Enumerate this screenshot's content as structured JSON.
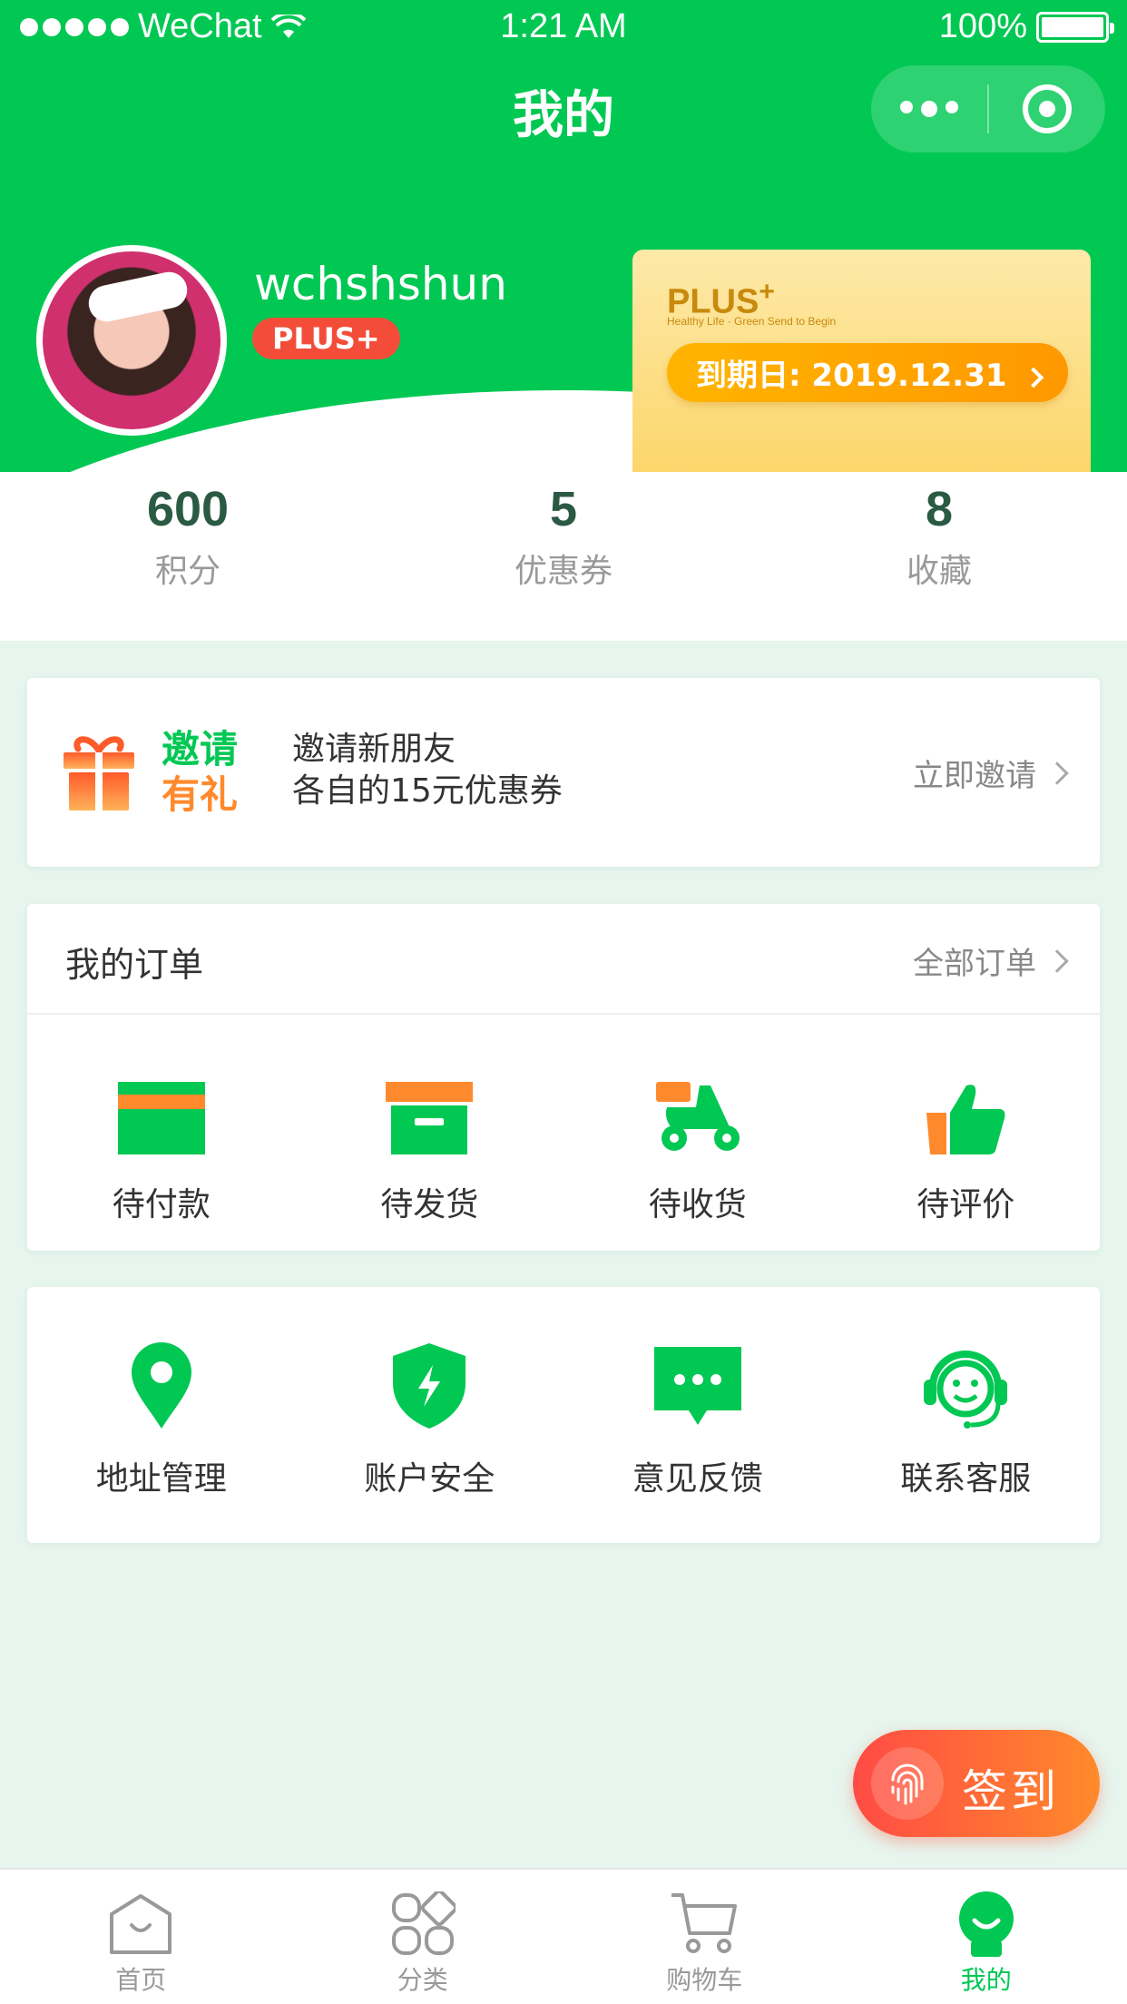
{
  "status_bar": {
    "carrier": "WeChat",
    "time": "1:21 AM",
    "battery": "100%"
  },
  "header": {
    "title": "我的"
  },
  "profile": {
    "username": "wchshshun",
    "badge": "PLUS+",
    "plus_card": {
      "brand": "PLUS",
      "slogan": "Healthy Life · Green Send to Begin",
      "expire_label": "到期日: 2019.12.31"
    }
  },
  "stats": [
    {
      "value": "600",
      "label": "积分"
    },
    {
      "value": "5",
      "label": "优惠券"
    },
    {
      "value": "8",
      "label": "收藏"
    }
  ],
  "invite": {
    "tag_line1": "邀请",
    "tag_line2": "有礼",
    "text_line1": "邀请新朋友",
    "text_line2": "各自的15元优惠券",
    "action": "立即邀请"
  },
  "orders": {
    "title": "我的订单",
    "all_link": "全部订单",
    "items": [
      {
        "label": "待付款",
        "icon": "card-icon"
      },
      {
        "label": "待发货",
        "icon": "box-icon"
      },
      {
        "label": "待收货",
        "icon": "scooter-icon"
      },
      {
        "label": "待评价",
        "icon": "thumbs-up-icon"
      }
    ]
  },
  "services": {
    "items": [
      {
        "label": "地址管理",
        "icon": "location-pin-icon"
      },
      {
        "label": "账户安全",
        "icon": "shield-icon"
      },
      {
        "label": "意见反馈",
        "icon": "chat-bubble-icon"
      },
      {
        "label": "联系客服",
        "icon": "headset-icon"
      }
    ]
  },
  "sign_in": {
    "label": "签到"
  },
  "tabbar": [
    {
      "label": "首页",
      "icon": "home-icon",
      "active": false
    },
    {
      "label": "分类",
      "icon": "category-icon",
      "active": false
    },
    {
      "label": "购物车",
      "icon": "cart-icon",
      "active": false
    },
    {
      "label": "我的",
      "icon": "profile-icon",
      "active": true
    }
  ],
  "colors": {
    "brand_green": "#00c853",
    "accent_orange": "#ff8a2d",
    "badge_red": "#f34d3a"
  }
}
